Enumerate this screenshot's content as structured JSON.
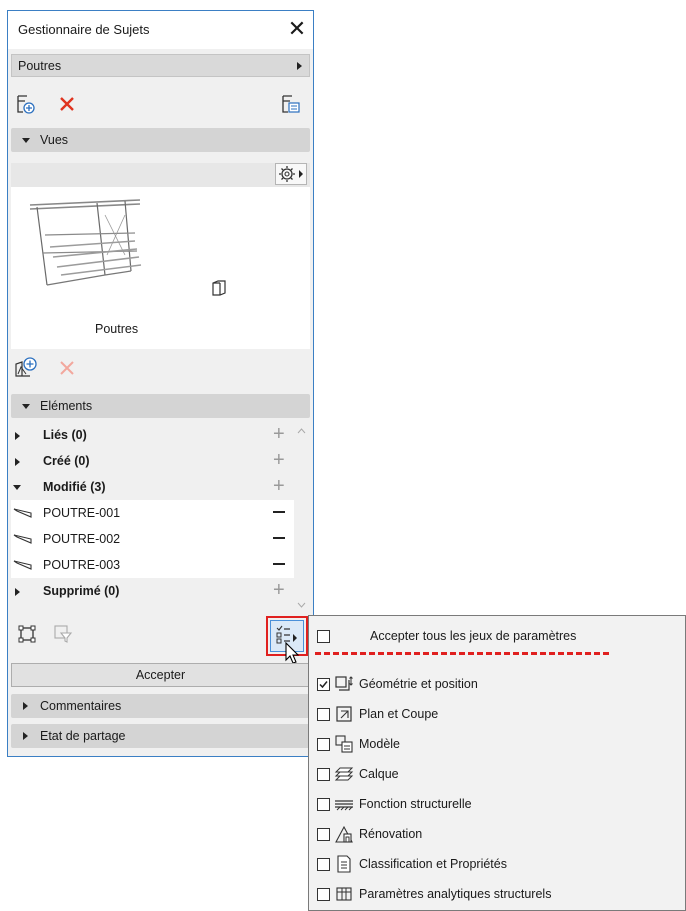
{
  "palette": {
    "title": "Gestionnaire de Sujets",
    "close_glyph": "✕",
    "selector_value": "Poutres",
    "views_section": {
      "label": "Vues",
      "view_name": "Poutres"
    },
    "elements_section": {
      "label": "Eléments",
      "groups": [
        {
          "label": "Liés (0)",
          "expanded": false
        },
        {
          "label": "Créé (0)",
          "expanded": false
        },
        {
          "label": "Modifié (3)",
          "expanded": true,
          "items": [
            "POUTRE-001",
            "POUTRE-002",
            "POUTRE-003"
          ]
        },
        {
          "label": "Supprimé (0)",
          "expanded": false
        }
      ]
    },
    "accept_label": "Accepter",
    "comments_label": "Commentaires",
    "sharing_label": "Etat de partage"
  },
  "menu": {
    "accept_all": {
      "label": "Accepter tous les jeux de paramètres",
      "checked": false
    },
    "items": [
      {
        "label": "Géométrie et position",
        "checked": true,
        "icon": "geometry-icon"
      },
      {
        "label": "Plan et Coupe",
        "checked": false,
        "icon": "plan-section-icon"
      },
      {
        "label": "Modèle",
        "checked": false,
        "icon": "model-icon"
      },
      {
        "label": "Calque",
        "checked": false,
        "icon": "layer-icon"
      },
      {
        "label": "Fonction structurelle",
        "checked": false,
        "icon": "structural-function-icon"
      },
      {
        "label": "Rénovation",
        "checked": false,
        "icon": "renovation-icon"
      },
      {
        "label": "Classification et Propriétés",
        "checked": false,
        "icon": "classification-icon"
      },
      {
        "label": "Paramètres analytiques structurels",
        "checked": false,
        "icon": "structural-analytical-icon"
      }
    ]
  },
  "colors": {
    "accent_blue": "#3b7fc4",
    "delete_red": "#e0331f",
    "highlight_red": "#e0201f",
    "dashed_red": "#e0201f"
  }
}
